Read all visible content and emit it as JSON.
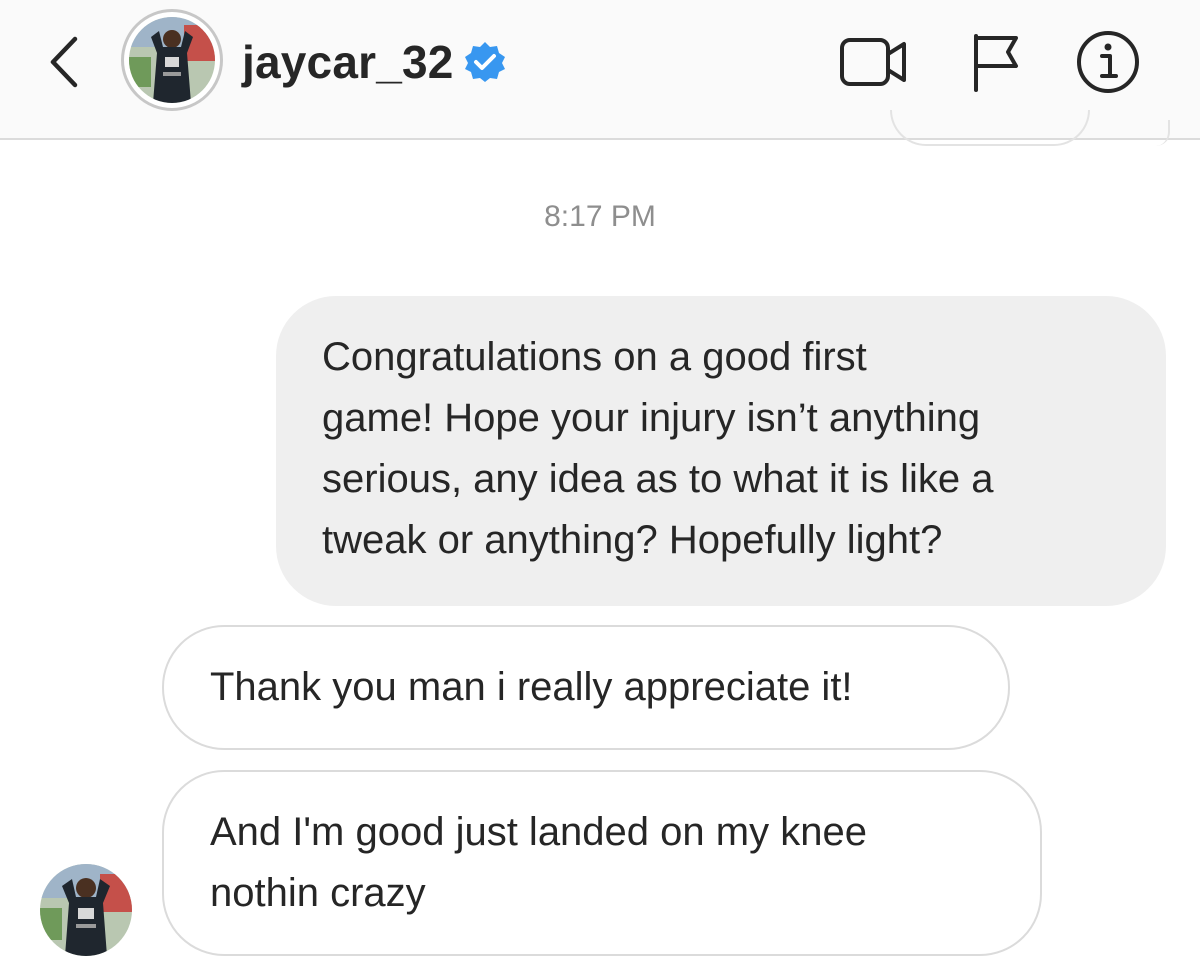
{
  "header": {
    "back_icon": "chevron-left-icon",
    "username": "jaycar_32",
    "verified_icon": "verified-badge-icon",
    "verified_color": "#3897f0",
    "actions": [
      {
        "name": "video-call",
        "icon": "video-camera-icon"
      },
      {
        "name": "report",
        "icon": "flag-icon"
      },
      {
        "name": "details",
        "icon": "info-icon"
      }
    ]
  },
  "thread": {
    "timestamp": "8:17 PM",
    "messages": [
      {
        "direction": "sent",
        "lines": [
          "Congratulations on a good first",
          "game! Hope your injury isn’t anything",
          "serious, any idea as to what it is like a",
          "tweak or anything? Hopefully light?"
        ]
      },
      {
        "direction": "received",
        "lines": [
          "Thank you man i really appreciate it!"
        ]
      },
      {
        "direction": "received",
        "lines": [
          "And I'm good just landed on my knee",
          "nothin crazy"
        ]
      }
    ]
  },
  "colors": {
    "header_bg": "#fafafa",
    "divider": "#dbdbdb",
    "sent_bubble_bg": "#efefef",
    "received_bubble_border": "#dbdbdb",
    "text": "#262626",
    "timestamp_text": "#8e8e8e"
  }
}
